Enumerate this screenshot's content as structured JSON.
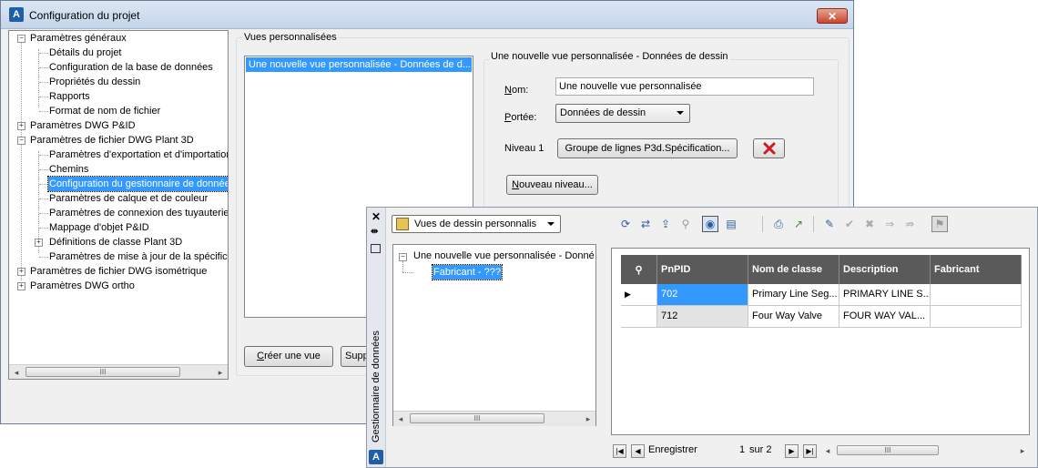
{
  "config_window": {
    "title": "Configuration du projet",
    "close_glyph": "✕",
    "tree": [
      {
        "label": "Paramètres généraux",
        "expander": "−"
      },
      {
        "label": "Détails du projet"
      },
      {
        "label": "Configuration de la base de données"
      },
      {
        "label": "Propriétés du dessin"
      },
      {
        "label": "Rapports"
      },
      {
        "label": "Format de nom de fichier"
      },
      {
        "label": "Paramètres DWG P&ID",
        "expander": "+"
      },
      {
        "label": "Paramètres de fichier DWG Plant 3D",
        "expander": "−"
      },
      {
        "label": "Paramètres d'exportation et d'importation"
      },
      {
        "label": "Chemins"
      },
      {
        "label": "Configuration du gestionnaire de données"
      },
      {
        "label": "Paramètres de calque et de couleur"
      },
      {
        "label": "Paramètres de connexion des tuyauteries"
      },
      {
        "label": "Mappage d'objet P&ID"
      },
      {
        "label": "Définitions de classe Plant 3D",
        "expander": "+"
      },
      {
        "label": "Paramètres de mise à jour de la spécification"
      },
      {
        "label": "Paramètres de fichier DWG isométrique",
        "expander": "+"
      },
      {
        "label": "Paramètres DWG ortho",
        "expander": "+"
      }
    ],
    "scroll_thumb": "III",
    "group_label": "Vues personnalisées",
    "views_list": [
      "Une nouvelle vue personnalisée - Données de d..."
    ],
    "detail_title": "Une nouvelle vue personnalisée - Données de dessin",
    "name_label": "Nom:",
    "name_value": "Une nouvelle vue personnalisée",
    "scope_label": "Portée:",
    "scope_value": "Données de dessin",
    "level_label": "Niveau 1",
    "level_button": "Groupe de lignes P3d.Spécification...",
    "new_level_button": "Nouveau niveau...",
    "create_view_button": "Créer une vue",
    "delete_view_button_partial": "Supp"
  },
  "data_manager": {
    "vertical_title": "Gestionnaire de données",
    "view_combo": "Vues de dessin personnalis",
    "tree": [
      {
        "label": "Une nouvelle vue personnalisée - Donné"
      },
      {
        "label": "Fabricant - ???"
      }
    ],
    "tree_scroll_thumb": "III",
    "grid": {
      "columns": [
        "PnPID",
        "Nom de classe",
        "Description",
        "Fabricant"
      ],
      "rows": [
        {
          "indicator": "▶",
          "PnPID": "702",
          "class": "Primary Line Seg...",
          "description": "PRIMARY LINE S...",
          "fabricant": ""
        },
        {
          "indicator": "",
          "PnPID": "712",
          "class": "Four Way Valve",
          "description": "FOUR WAY VAL...",
          "fabricant": ""
        }
      ]
    },
    "nav": {
      "record_label": "Enregistrer",
      "page": "1",
      "of_label": "sur 2",
      "scroll_thumb": "III"
    }
  }
}
